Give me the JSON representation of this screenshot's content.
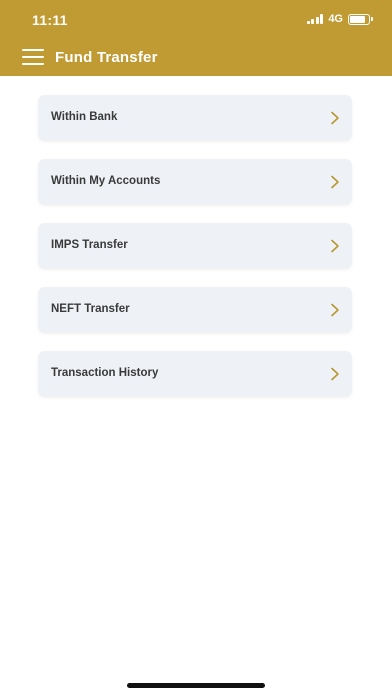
{
  "status_bar": {
    "time": "11:11",
    "network": "4G"
  },
  "app_bar": {
    "title": "Fund Transfer",
    "menu_icon": "hamburger-menu-icon"
  },
  "menu": {
    "items": [
      {
        "label": "Within Bank",
        "icon": "chevron-right-icon"
      },
      {
        "label": "Within My Accounts",
        "icon": "chevron-right-icon"
      },
      {
        "label": "IMPS Transfer",
        "icon": "chevron-right-icon"
      },
      {
        "label": "NEFT Transfer",
        "icon": "chevron-right-icon"
      },
      {
        "label": "Transaction History",
        "icon": "chevron-right-icon"
      }
    ]
  },
  "colors": {
    "header_background": "#c09a33",
    "card_background": "#eef1f5",
    "chevron": "#b8962f",
    "label_text": "#3a3a3a"
  }
}
